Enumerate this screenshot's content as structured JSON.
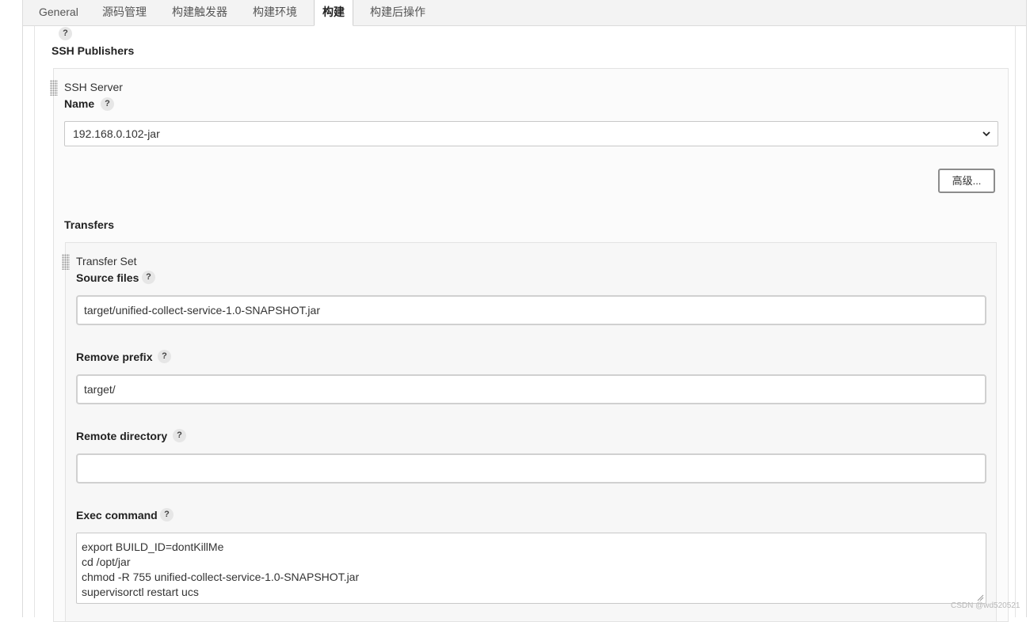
{
  "tabs": [
    {
      "label": "General"
    },
    {
      "label": "源码管理"
    },
    {
      "label": "构建触发器"
    },
    {
      "label": "构建环境"
    },
    {
      "label": "构建",
      "active": true
    },
    {
      "label": "构建后操作"
    }
  ],
  "help_symbol": "?",
  "section": {
    "title": "SSH Publishers"
  },
  "ssh_server": {
    "header": "SSH Server",
    "name_label": "Name",
    "name_value": "192.168.0.102-jar",
    "advanced_button": "高级..."
  },
  "transfers": {
    "title": "Transfers",
    "set_header": "Transfer Set",
    "source_files_label": "Source files",
    "source_files_value": "target/unified-collect-service-1.0-SNAPSHOT.jar",
    "remove_prefix_label": "Remove prefix",
    "remove_prefix_value": "target/",
    "remote_directory_label": "Remote directory",
    "remote_directory_value": "",
    "exec_command_label": "Exec command",
    "exec_command_lines": [
      "export BUILD_ID=dontKillMe",
      "cd /opt/jar",
      "chmod -R 755 unified-collect-service-1.0-SNAPSHOT.jar",
      "supervisorctl restart ucs"
    ]
  },
  "watermark": "CSDN @wd520521",
  "icons": {
    "help": "help-icon",
    "dropdown": "chevron-down-icon",
    "drag": "drag-handle-icon",
    "resize": "resize-handle-icon"
  },
  "colors": {
    "tab_bar": "#f3f3f3",
    "panel": "#fbfbfb",
    "input_border": "#d0d0d0",
    "text": "#333333"
  }
}
